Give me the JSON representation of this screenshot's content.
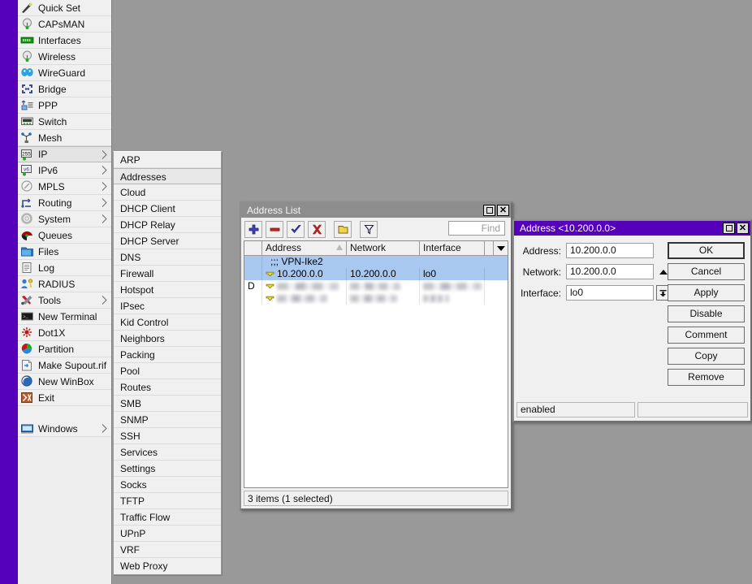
{
  "desktop": {
    "background_color": "#999999",
    "accent_color": "#5500bb"
  },
  "sidebar": {
    "items": [
      {
        "label": "Quick Set",
        "icon": "wand-icon",
        "arrow": false,
        "selected": false
      },
      {
        "label": "CAPsMAN",
        "icon": "antenna-icon",
        "arrow": false,
        "selected": false
      },
      {
        "label": "Interfaces",
        "icon": "interfaces-icon",
        "arrow": false,
        "selected": false
      },
      {
        "label": "Wireless",
        "icon": "antenna-icon",
        "arrow": false,
        "selected": false
      },
      {
        "label": "WireGuard",
        "icon": "wireguard-icon",
        "arrow": false,
        "selected": false
      },
      {
        "label": "Bridge",
        "icon": "bridge-icon",
        "arrow": false,
        "selected": false
      },
      {
        "label": "PPP",
        "icon": "ppp-icon",
        "arrow": false,
        "selected": false
      },
      {
        "label": "Switch",
        "icon": "switch-icon",
        "arrow": false,
        "selected": false
      },
      {
        "label": "Mesh",
        "icon": "mesh-icon",
        "arrow": false,
        "selected": false
      },
      {
        "label": "IP",
        "icon": "ip-255-icon",
        "arrow": true,
        "selected": true
      },
      {
        "label": "IPv6",
        "icon": "ipv6-icon",
        "arrow": true,
        "selected": false
      },
      {
        "label": "MPLS",
        "icon": "mpls-icon",
        "arrow": true,
        "selected": false
      },
      {
        "label": "Routing",
        "icon": "routing-icon",
        "arrow": true,
        "selected": false
      },
      {
        "label": "System",
        "icon": "gear-icon",
        "arrow": true,
        "selected": false
      },
      {
        "label": "Queues",
        "icon": "queues-icon",
        "arrow": false,
        "selected": false
      },
      {
        "label": "Files",
        "icon": "folder-icon",
        "arrow": false,
        "selected": false
      },
      {
        "label": "Log",
        "icon": "log-icon",
        "arrow": false,
        "selected": false
      },
      {
        "label": "RADIUS",
        "icon": "radius-icon",
        "arrow": false,
        "selected": false
      },
      {
        "label": "Tools",
        "icon": "tools-icon",
        "arrow": true,
        "selected": false
      },
      {
        "label": "New Terminal",
        "icon": "terminal-icon",
        "arrow": false,
        "selected": false
      },
      {
        "label": "Dot1X",
        "icon": "dot1x-icon",
        "arrow": false,
        "selected": false
      },
      {
        "label": "Partition",
        "icon": "partition-icon",
        "arrow": false,
        "selected": false
      },
      {
        "label": "Make Supout.rif",
        "icon": "supout-icon",
        "arrow": false,
        "selected": false
      },
      {
        "label": "New WinBox",
        "icon": "winbox-icon",
        "arrow": false,
        "selected": false
      },
      {
        "label": "Exit",
        "icon": "exit-icon",
        "arrow": false,
        "selected": false
      },
      {
        "label": "",
        "icon": "spacer",
        "arrow": false,
        "selected": false
      },
      {
        "label": "Windows",
        "icon": "windows-icon",
        "arrow": true,
        "selected": false
      }
    ]
  },
  "ip_submenu": {
    "items": [
      {
        "label": "ARP",
        "selected": false
      },
      {
        "label": "Addresses",
        "selected": true
      },
      {
        "label": "Cloud",
        "selected": false
      },
      {
        "label": "DHCP Client",
        "selected": false
      },
      {
        "label": "DHCP Relay",
        "selected": false
      },
      {
        "label": "DHCP Server",
        "selected": false
      },
      {
        "label": "DNS",
        "selected": false
      },
      {
        "label": "Firewall",
        "selected": false
      },
      {
        "label": "Hotspot",
        "selected": false
      },
      {
        "label": "IPsec",
        "selected": false
      },
      {
        "label": "Kid Control",
        "selected": false
      },
      {
        "label": "Neighbors",
        "selected": false
      },
      {
        "label": "Packing",
        "selected": false
      },
      {
        "label": "Pool",
        "selected": false
      },
      {
        "label": "Routes",
        "selected": false
      },
      {
        "label": "SMB",
        "selected": false
      },
      {
        "label": "SNMP",
        "selected": false
      },
      {
        "label": "SSH",
        "selected": false
      },
      {
        "label": "Services",
        "selected": false
      },
      {
        "label": "Settings",
        "selected": false
      },
      {
        "label": "Socks",
        "selected": false
      },
      {
        "label": "TFTP",
        "selected": false
      },
      {
        "label": "Traffic Flow",
        "selected": false
      },
      {
        "label": "UPnP",
        "selected": false
      },
      {
        "label": "VRF",
        "selected": false
      },
      {
        "label": "Web Proxy",
        "selected": false
      }
    ]
  },
  "address_list_window": {
    "title": "Address List",
    "active": false,
    "toolbar": {
      "add_label": "+",
      "remove_label": "-",
      "enable_label": "check",
      "disable_label": "x",
      "comment_label": "comment",
      "filter_label": "filter"
    },
    "find": {
      "value": "",
      "placeholder": "Find"
    },
    "columns": [
      "",
      "Address",
      "Network",
      "Interface",
      ""
    ],
    "sorted_column": "Address",
    "rows": [
      {
        "type": "comment",
        "flag": "",
        "comment": ";;; VPN-Ike2",
        "selected": true
      },
      {
        "type": "entry",
        "flag": "",
        "address": "10.200.0.0",
        "network": "10.200.0.0",
        "interface": "lo0",
        "selected": true,
        "redacted": false
      },
      {
        "type": "entry",
        "flag": "D",
        "address": "",
        "network": "",
        "interface": "",
        "selected": false,
        "redacted": true
      },
      {
        "type": "entry",
        "flag": "",
        "address": "",
        "network": "",
        "interface": "",
        "selected": false,
        "redacted": true
      }
    ],
    "status": "3 items (1 selected)"
  },
  "address_dialog": {
    "title": "Address <10.200.0.0>",
    "active": true,
    "fields": [
      {
        "label": "Address:",
        "value": "10.200.0.0",
        "adorn": "none"
      },
      {
        "label": "Network:",
        "value": "10.200.0.0",
        "adorn": "triangle-up"
      },
      {
        "label": "Interface:",
        "value": "lo0",
        "adorn": "dropdown-arrow"
      }
    ],
    "buttons": [
      {
        "label": "OK",
        "default": true
      },
      {
        "label": "Cancel",
        "default": false
      },
      {
        "label": "Apply",
        "default": false
      },
      {
        "label": "Disable",
        "default": false
      },
      {
        "label": "Comment",
        "default": false
      },
      {
        "label": "Copy",
        "default": false
      },
      {
        "label": "Remove",
        "default": false
      }
    ],
    "status_left": "enabled",
    "status_right": ""
  }
}
